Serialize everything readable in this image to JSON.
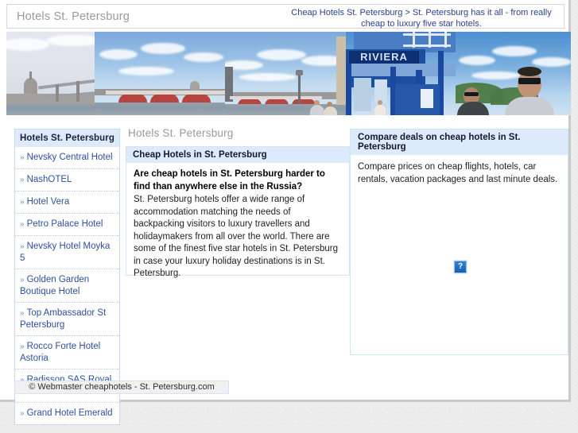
{
  "header": {
    "title": "Hotels St. Petersburg",
    "tagline": "Cheap Hotels St. Petersburg > St. Petersburg has it all - from really cheap to luxury five star hotels."
  },
  "banner": {
    "riviera_sign": "RIVIERA"
  },
  "sidebar": {
    "heading": "Hotels St. Petersburg",
    "bullet": "»",
    "items": [
      {
        "label": "Nevsky Central Hotel"
      },
      {
        "label": "NashOTEL"
      },
      {
        "label": "Hotel Vera"
      },
      {
        "label": "Petro Palace Hotel"
      },
      {
        "label": "Nevsky Hotel Moyka 5"
      },
      {
        "label": "Golden Garden Boutique Hotel"
      },
      {
        "label": "Top Ambassador St Petersburg"
      },
      {
        "label": "Rocco Forte Hotel Astoria"
      },
      {
        "label": "Radisson SAS Royal Hotel"
      },
      {
        "label": "Grand Hotel Emerald"
      }
    ]
  },
  "main": {
    "page_title": "Hotels St. Petersburg",
    "panel_heading": "Cheap Hotels in St. Petersburg",
    "lead": "Are cheap hotels in St. Petersburg harder to find than anywhere else in the Russia?",
    "body": "St. Petersburg hotels offer a wide range of accommodation matching the needs of backpacking visitors to luxury travellers and holidaymakers from all over the world. There are some of the finest five star hotels in St. Petersburg in case your luxury holiday destinations is in St. Petersburg."
  },
  "right": {
    "heading": "Compare deals on cheap hotels in St. Petersburg",
    "body": "Compare prices on cheap flights, hotels, car rentals, vacation packages and last minute deals.",
    "broken_image_glyph": "?"
  },
  "footer": {
    "text": "© Webmaster cheaphotels - St. Petersburg.com"
  },
  "colors": {
    "panel_header_bg": "#dceafb",
    "link": "#2e4f9e",
    "tagline": "#2b3f8f",
    "page_bg": "#ebebeb"
  }
}
